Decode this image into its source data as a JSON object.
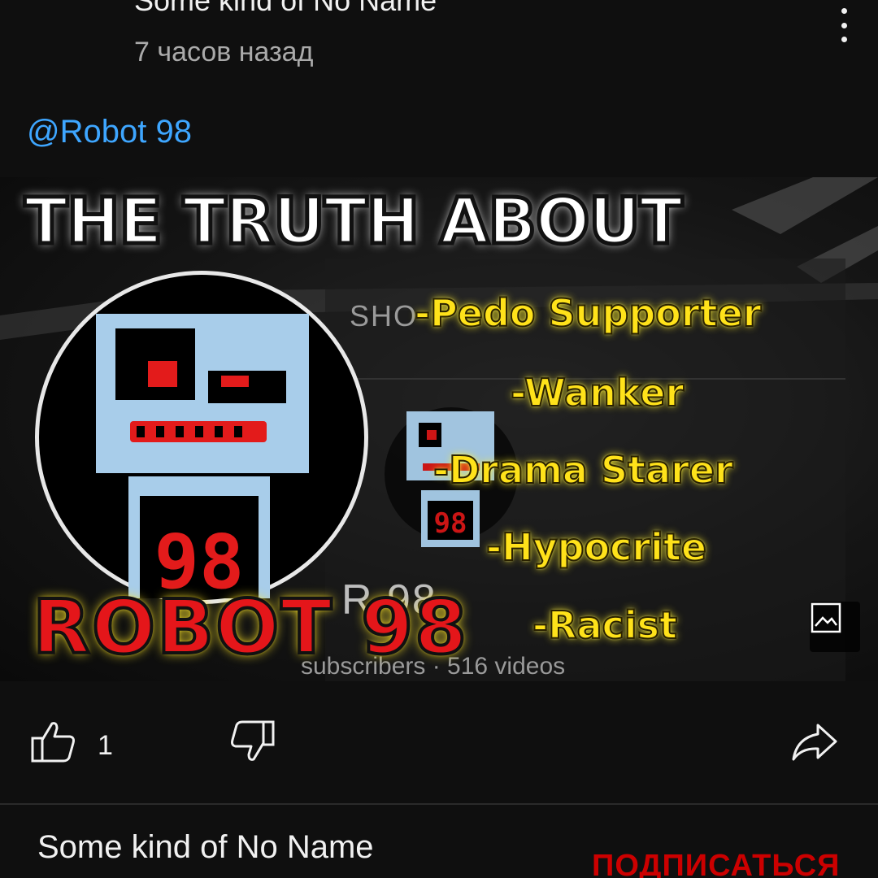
{
  "post": {
    "channel_name": "Some kind of No Name",
    "time": "7 часов назад",
    "mention": "@Robot 98",
    "more_icon": "more-vert-icon"
  },
  "image": {
    "title": "THE TRUTH ABOUT",
    "badges": [
      "-Pedo Supporter",
      "-Wanker",
      "-Drama Starer",
      "-Hypocrite",
      "-Racist"
    ],
    "robot_name": "ROBOT 98",
    "bg_shorts": "SHO",
    "bg_channel": "R     98",
    "bg_subs": "subscribers · 516 videos",
    "avatar_number": "98",
    "colors": {
      "badge_yellow": "#ffe21a",
      "name_red": "#e4161a",
      "robot_blue": "#a8cdea"
    }
  },
  "actions": {
    "like_count": "1"
  },
  "footer": {
    "channel_name": "Some kind of No Name",
    "subscribe_label": "ПОДПИСАТЬСЯ"
  },
  "colors": {
    "background": "#0f0f0f",
    "mention": "#3ea6ff",
    "subscribe": "#cc0000"
  }
}
